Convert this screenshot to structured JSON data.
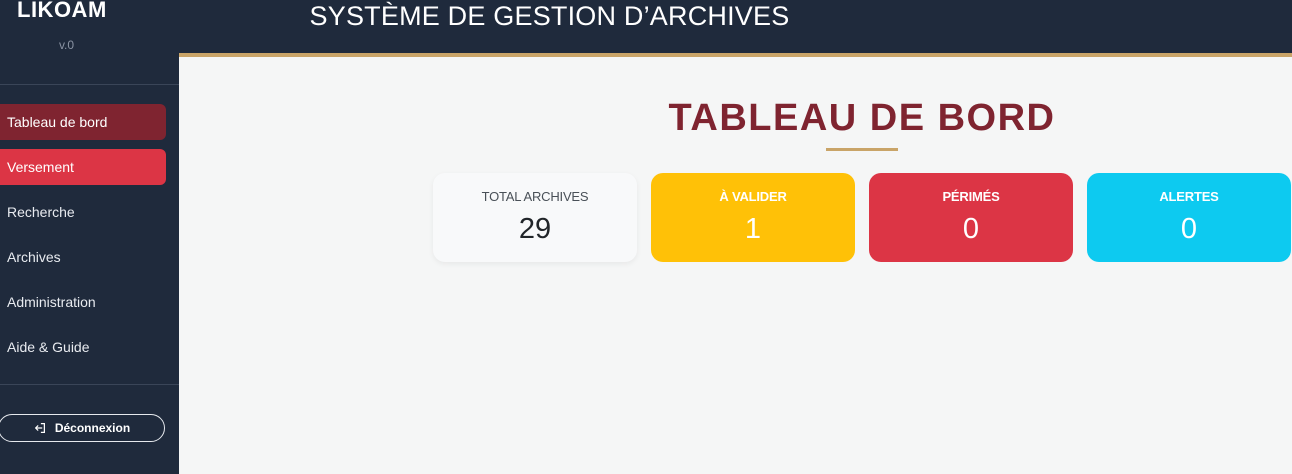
{
  "sidebar": {
    "brand": "LIKOAM",
    "version": "v.0",
    "items": [
      {
        "label": "Tableau de bord"
      },
      {
        "label": "Versement"
      },
      {
        "label": "Recherche"
      },
      {
        "label": "Archives"
      },
      {
        "label": "Administration"
      },
      {
        "label": "Aide & Guide"
      }
    ],
    "logout_label": "Déconnexion",
    "logout_icon": "logout-icon"
  },
  "header": {
    "title": "SYSTÈME DE GESTION D’ARCHIVES"
  },
  "main": {
    "page_title": "TABLEAU DE BORD",
    "cards": [
      {
        "label": "TOTAL ARCHIVES",
        "value": "29"
      },
      {
        "label": "À VALIDER",
        "value": "1"
      },
      {
        "label": "PÉRIMÉS",
        "value": "0"
      },
      {
        "label": "ALERTES",
        "value": "0"
      }
    ]
  },
  "colors": {
    "sidebar_bg": "#1f2a3c",
    "accent_gold": "#c9a468",
    "brand_red": "#7f2430",
    "danger": "#dc3545",
    "warning": "#ffc107",
    "info": "#0dcaf0"
  }
}
